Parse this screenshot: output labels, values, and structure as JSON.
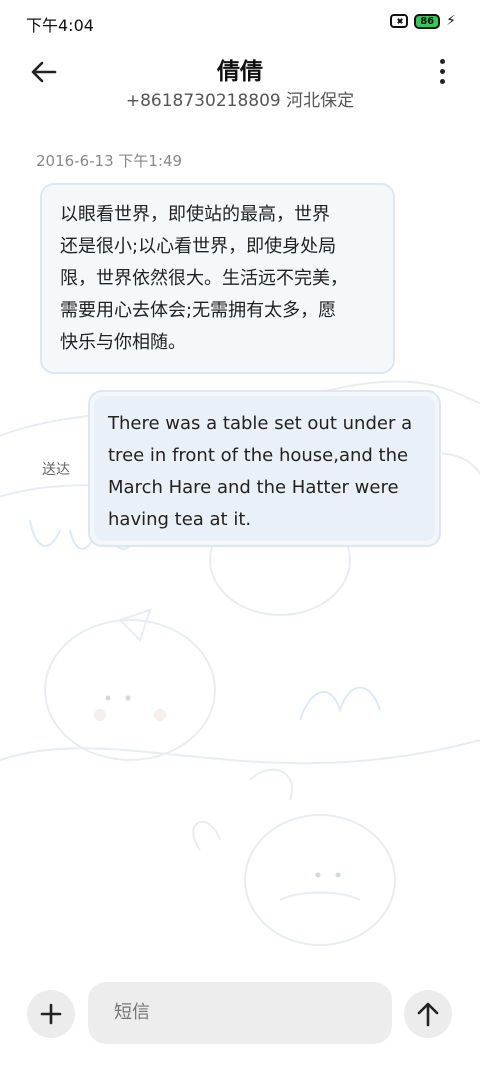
{
  "status_bar": {
    "time": "下午4:04",
    "battery": "86",
    "icons": [
      "sim-off-icon",
      "battery-icon",
      "charging-bolt-icon"
    ]
  },
  "header": {
    "title": "倩倩",
    "subtitle": "+8618730218809 河北保定",
    "back_icon": "back-arrow-icon",
    "more_icon": "more-vertical-icon"
  },
  "conversation": {
    "timestamp": "2016-6-13 下午1:49",
    "messages": [
      {
        "direction": "incoming",
        "lines": [
          "以眼看世界，即使站的最高，世界",
          "还是很小;以心看世界，即使身处局",
          "限，世界依然很大。生活远不完美，",
          "需要用心去体会;无需拥有太多，愿",
          "快乐与你相随。"
        ]
      },
      {
        "direction": "outgoing",
        "lines": [
          "There was a table set out under a",
          "tree in front of the house,and the",
          "March Hare and the Hatter were",
          "having tea at it."
        ],
        "status": "送达"
      }
    ]
  },
  "composer": {
    "placeholder": "短信",
    "add_icon": "plus-icon",
    "send_icon": "send-arrow-icon"
  },
  "colors": {
    "incoming_bubble": "#f5f8fb",
    "outgoing_bubble": "#e9f0f7",
    "bubble_border": "#dbe8f4",
    "battery": "#35c759"
  }
}
